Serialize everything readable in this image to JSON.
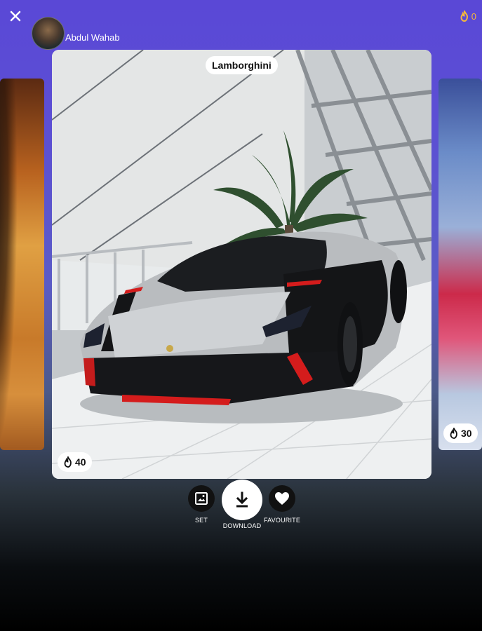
{
  "header": {
    "username": "Abdul Wahab",
    "coin_count": "0"
  },
  "wallpaper": {
    "title": "Lamborghini",
    "likes": "40"
  },
  "next_wallpaper": {
    "likes": "30"
  },
  "actions": {
    "set_label": "SET",
    "download_label": "DOWNLOAD",
    "favourite_label": "FAVOURITE"
  },
  "icons": [
    "close-icon",
    "fire-icon",
    "set-wallpaper-icon",
    "download-icon",
    "heart-icon"
  ],
  "colors": {
    "header_bg": "#5a48d6",
    "coin_accent": "#f5b83b",
    "pill_bg": "#ffffff"
  }
}
